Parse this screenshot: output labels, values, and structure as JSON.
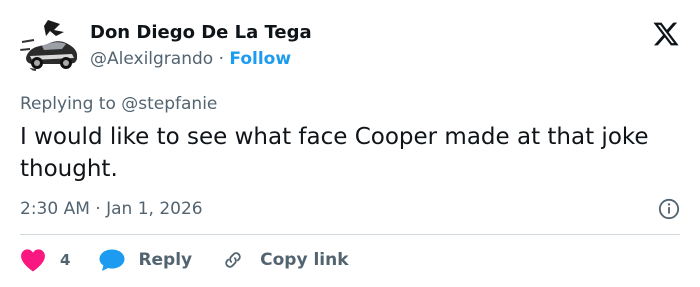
{
  "author": {
    "display_name": "Don Diego De La Tega",
    "handle": "@Alexilgrando",
    "separator": "·",
    "follow_label": "Follow",
    "avatar_icon": "sports-car-avatar"
  },
  "brand": {
    "logo_icon": "x-logo-icon"
  },
  "reply_context": {
    "prefix": "Replying to",
    "mention": "@stepfanie"
  },
  "tweet": {
    "text": "I would like to see what face Cooper made at that joke thought.",
    "time": "2:30 AM",
    "separator": "·",
    "date": "Jan 1, 2026",
    "info_icon": "info-icon"
  },
  "actions": {
    "like_count": "4",
    "reply_label": "Reply",
    "copy_label": "Copy link"
  },
  "colors": {
    "accent": "#1d9bf0",
    "like": "#f91880",
    "text": "#0f1419",
    "secondary": "#536471",
    "divider": "#cfd9de"
  }
}
